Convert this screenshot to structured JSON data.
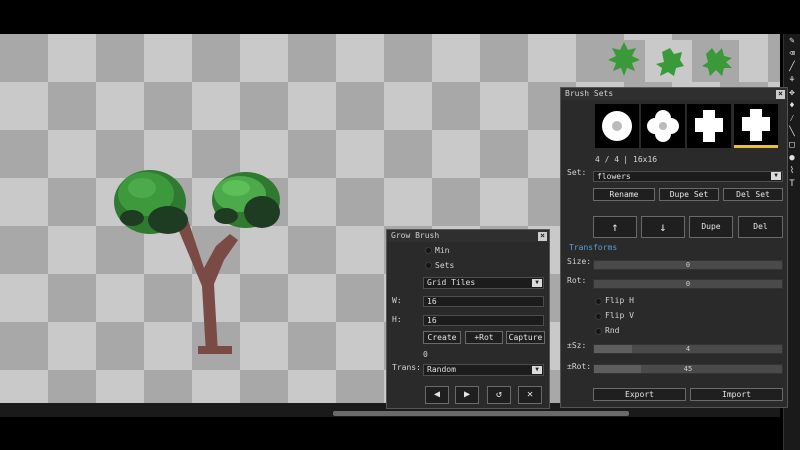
{
  "grow_brush": {
    "title": "Grow Brush",
    "min_label": "Min",
    "sets_label": "Sets",
    "mode_select": "Grid Tiles",
    "w_label": "W:",
    "w_value": "16",
    "h_label": "H:",
    "h_value": "16",
    "create_label": "Create",
    "rot_label": "+Rot",
    "capture_label": "Capture",
    "count_value": "0",
    "trans_label": "Trans:",
    "trans_select": "Random",
    "prev_icon": "◀",
    "next_icon": "▶",
    "reset_icon": "↺",
    "clear_icon": "✕"
  },
  "brush_sets": {
    "title": "Brush Sets",
    "counter": "4 / 4",
    "separator": "|",
    "size_info": "16x16",
    "set_label": "Set:",
    "set_value": "flowers",
    "rename_label": "Rename",
    "dupe_set_label": "Dupe Set",
    "del_set_label": "Del Set",
    "up_icon": "↑",
    "down_icon": "↓",
    "dupe_label": "Dupe",
    "del_label": "Del",
    "transforms_heading": "Transforms",
    "size_label": "Size:",
    "size_value": "0",
    "rot_label": "Rot:",
    "rot_value": "0",
    "flip_h_label": "Flip H",
    "flip_v_label": "Flip V",
    "rnd_label": "Rnd",
    "psz_label": "±Sz:",
    "psz_value": "4",
    "psz_fraction": 0.2,
    "prot_label": "±Rot:",
    "prot_value": "45",
    "prot_fraction": 0.25,
    "export_label": "Export",
    "import_label": "Import"
  },
  "toolbar_icons": [
    "pencil-icon",
    "eraser-icon",
    "brush-icon",
    "grow-icon",
    "move-icon",
    "fill-icon",
    "picker-icon",
    "line-icon",
    "rect-icon",
    "ellipse-icon",
    "smudge-icon",
    "text-icon"
  ],
  "colors": {
    "accent": "#e8c040",
    "transforms_heading": "#5a9ad8",
    "tree_trunk": "#7a4a44",
    "leaf_light": "#3c9a3c",
    "leaf_mid": "#2f7a30",
    "leaf_dark": "#1e3c22",
    "swatch_green": "#3a9a3a"
  }
}
